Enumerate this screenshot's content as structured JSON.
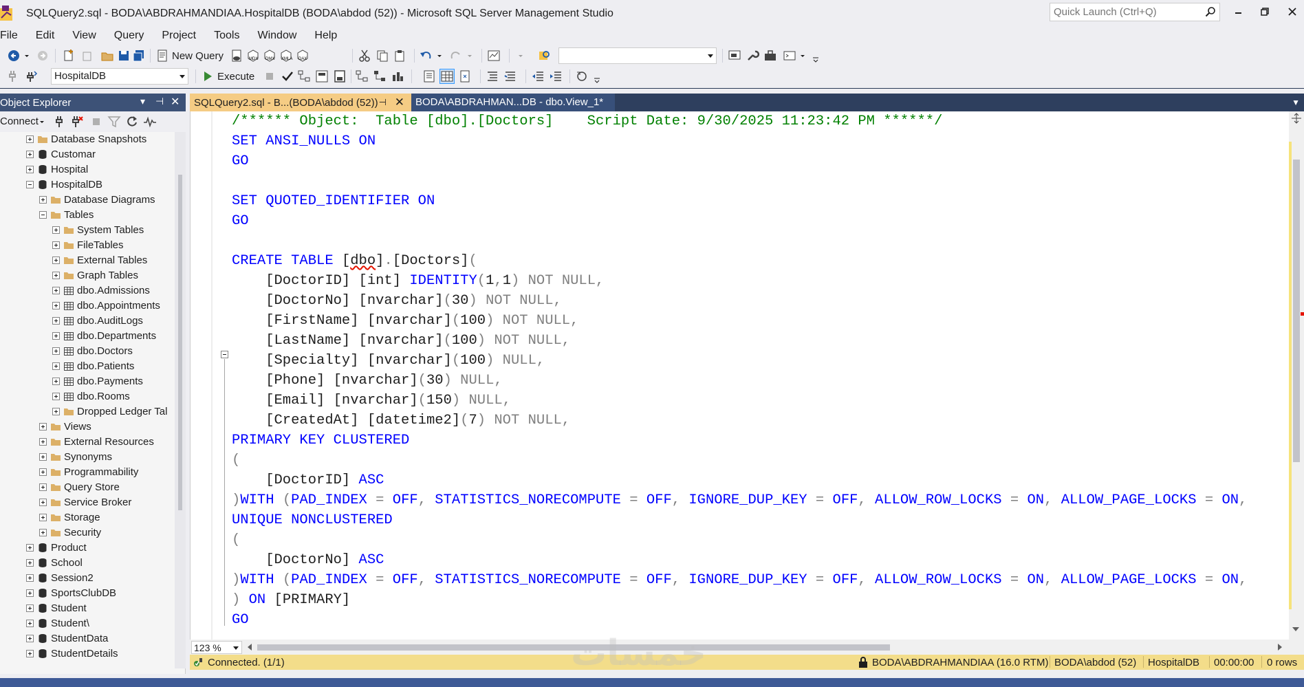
{
  "window": {
    "title": "SQLQuery2.sql - BODA\\ABDRAHMANDIAA.HospitalDB (BODA\\abdod (52)) - Microsoft SQL Server Management Studio",
    "quick_launch_placeholder": "Quick Launch (Ctrl+Q)"
  },
  "menu": [
    "File",
    "Edit",
    "View",
    "Query",
    "Project",
    "Tools",
    "Window",
    "Help"
  ],
  "toolbar": {
    "new_query": "New Query",
    "execute": "Execute",
    "database": "HospitalDB",
    "solution_config": ""
  },
  "object_explorer": {
    "title": "Object Explorer",
    "connect": "Connect",
    "items": [
      {
        "label": "Database Snapshots",
        "level": 0,
        "icon": "folder",
        "exp": "plus"
      },
      {
        "label": "Customar",
        "level": 0,
        "icon": "db",
        "exp": "plus"
      },
      {
        "label": "Hospital",
        "level": 0,
        "icon": "db",
        "exp": "plus"
      },
      {
        "label": "HospitalDB",
        "level": 0,
        "icon": "db",
        "exp": "minus"
      },
      {
        "label": "Database Diagrams",
        "level": 1,
        "icon": "folder",
        "exp": "plus"
      },
      {
        "label": "Tables",
        "level": 1,
        "icon": "folder",
        "exp": "minus"
      },
      {
        "label": "System Tables",
        "level": 2,
        "icon": "folder",
        "exp": "plus"
      },
      {
        "label": "FileTables",
        "level": 2,
        "icon": "folder",
        "exp": "plus"
      },
      {
        "label": "External Tables",
        "level": 2,
        "icon": "folder",
        "exp": "plus"
      },
      {
        "label": "Graph Tables",
        "level": 2,
        "icon": "folder",
        "exp": "plus"
      },
      {
        "label": "dbo.Admissions",
        "level": 2,
        "icon": "table",
        "exp": "plus"
      },
      {
        "label": "dbo.Appointments",
        "level": 2,
        "icon": "table",
        "exp": "plus"
      },
      {
        "label": "dbo.AuditLogs",
        "level": 2,
        "icon": "table",
        "exp": "plus"
      },
      {
        "label": "dbo.Departments",
        "level": 2,
        "icon": "table",
        "exp": "plus"
      },
      {
        "label": "dbo.Doctors",
        "level": 2,
        "icon": "table",
        "exp": "plus"
      },
      {
        "label": "dbo.Patients",
        "level": 2,
        "icon": "table",
        "exp": "plus"
      },
      {
        "label": "dbo.Payments",
        "level": 2,
        "icon": "table",
        "exp": "plus"
      },
      {
        "label": "dbo.Rooms",
        "level": 2,
        "icon": "table",
        "exp": "plus"
      },
      {
        "label": "Dropped Ledger Tal",
        "level": 2,
        "icon": "folder",
        "exp": "plus"
      },
      {
        "label": "Views",
        "level": 1,
        "icon": "folder",
        "exp": "plus"
      },
      {
        "label": "External Resources",
        "level": 1,
        "icon": "folder",
        "exp": "plus"
      },
      {
        "label": "Synonyms",
        "level": 1,
        "icon": "folder",
        "exp": "plus"
      },
      {
        "label": "Programmability",
        "level": 1,
        "icon": "folder",
        "exp": "plus"
      },
      {
        "label": "Query Store",
        "level": 1,
        "icon": "folder",
        "exp": "plus"
      },
      {
        "label": "Service Broker",
        "level": 1,
        "icon": "folder",
        "exp": "plus"
      },
      {
        "label": "Storage",
        "level": 1,
        "icon": "folder",
        "exp": "plus"
      },
      {
        "label": "Security",
        "level": 1,
        "icon": "folder",
        "exp": "plus"
      },
      {
        "label": "Product",
        "level": 0,
        "icon": "db",
        "exp": "plus"
      },
      {
        "label": "School",
        "level": 0,
        "icon": "db",
        "exp": "plus"
      },
      {
        "label": "Session2",
        "level": 0,
        "icon": "db",
        "exp": "plus"
      },
      {
        "label": "SportsClubDB",
        "level": 0,
        "icon": "db",
        "exp": "plus"
      },
      {
        "label": "Student",
        "level": 0,
        "icon": "db",
        "exp": "plus"
      },
      {
        "label": "Student\\",
        "level": 0,
        "icon": "db",
        "exp": "plus"
      },
      {
        "label": "StudentData",
        "level": 0,
        "icon": "db",
        "exp": "plus"
      },
      {
        "label": "StudentDetails",
        "level": 0,
        "icon": "db",
        "exp": "plus"
      }
    ]
  },
  "tabs": {
    "active": "SQLQuery2.sql - B...(BODA\\abdod (52))",
    "inactive": "BODA\\ABDRAHMAN...DB - dbo.View_1*"
  },
  "code_lines": [
    [
      [
        "cm",
        "/****** Object:  Table [dbo].[Doctors]    Script Date: 9/30/2025 11:23:42 PM ******/"
      ]
    ],
    [
      [
        "kw",
        "SET ANSI_NULLS ON"
      ]
    ],
    [
      [
        "kw",
        "GO"
      ]
    ],
    [
      [
        "tx",
        ""
      ]
    ],
    [
      [
        "kw",
        "SET QUOTED_IDENTIFIER ON"
      ]
    ],
    [
      [
        "kw",
        "GO"
      ]
    ],
    [
      [
        "tx",
        ""
      ]
    ],
    [
      [
        "kw",
        "CREATE TABLE "
      ],
      [
        "tx",
        "["
      ],
      [
        "sq",
        "dbo"
      ],
      [
        "tx",
        "]"
      ],
      [
        "gr",
        "."
      ],
      [
        "tx",
        "[Doctors]"
      ],
      [
        "gr",
        "("
      ]
    ],
    [
      [
        "tx",
        "    [DoctorID] [int] "
      ],
      [
        "kw",
        "IDENTITY"
      ],
      [
        "gr",
        "("
      ],
      [
        "tx",
        "1"
      ],
      [
        "gr",
        ","
      ],
      [
        "tx",
        "1"
      ],
      [
        "gr",
        ") NOT NULL,"
      ]
    ],
    [
      [
        "tx",
        "    [DoctorNo] [nvarchar]"
      ],
      [
        "gr",
        "("
      ],
      [
        "tx",
        "30"
      ],
      [
        "gr",
        ") NOT NULL,"
      ]
    ],
    [
      [
        "tx",
        "    [FirstName] [nvarchar]"
      ],
      [
        "gr",
        "("
      ],
      [
        "tx",
        "100"
      ],
      [
        "gr",
        ") NOT NULL,"
      ]
    ],
    [
      [
        "tx",
        "    [LastName] [nvarchar]"
      ],
      [
        "gr",
        "("
      ],
      [
        "tx",
        "100"
      ],
      [
        "gr",
        ") NOT NULL,"
      ]
    ],
    [
      [
        "tx",
        "    [Specialty] [nvarchar]"
      ],
      [
        "gr",
        "("
      ],
      [
        "tx",
        "100"
      ],
      [
        "gr",
        ") NULL,"
      ]
    ],
    [
      [
        "tx",
        "    [Phone] [nvarchar]"
      ],
      [
        "gr",
        "("
      ],
      [
        "tx",
        "30"
      ],
      [
        "gr",
        ") NULL,"
      ]
    ],
    [
      [
        "tx",
        "    [Email] [nvarchar]"
      ],
      [
        "gr",
        "("
      ],
      [
        "tx",
        "150"
      ],
      [
        "gr",
        ") NULL,"
      ]
    ],
    [
      [
        "tx",
        "    [CreatedAt] [datetime2]"
      ],
      [
        "gr",
        "("
      ],
      [
        "tx",
        "7"
      ],
      [
        "gr",
        ") NOT NULL,"
      ]
    ],
    [
      [
        "kw",
        "PRIMARY KEY CLUSTERED"
      ]
    ],
    [
      [
        "gr",
        "("
      ]
    ],
    [
      [
        "tx",
        "    [DoctorID] "
      ],
      [
        "kw",
        "ASC"
      ]
    ],
    [
      [
        "gr",
        ")"
      ],
      [
        "kw",
        "WITH "
      ],
      [
        "gr",
        "("
      ],
      [
        "kw",
        "PAD_INDEX "
      ],
      [
        "gr",
        "= "
      ],
      [
        "kw",
        "OFF"
      ],
      [
        "gr",
        ", "
      ],
      [
        "kw",
        "STATISTICS_NORECOMPUTE "
      ],
      [
        "gr",
        "= "
      ],
      [
        "kw",
        "OFF"
      ],
      [
        "gr",
        ", "
      ],
      [
        "kw",
        "IGNORE_DUP_KEY "
      ],
      [
        "gr",
        "= "
      ],
      [
        "kw",
        "OFF"
      ],
      [
        "gr",
        ", "
      ],
      [
        "kw",
        "ALLOW_ROW_LOCKS "
      ],
      [
        "gr",
        "= "
      ],
      [
        "kw",
        "ON"
      ],
      [
        "gr",
        ", "
      ],
      [
        "kw",
        "ALLOW_PAGE_LOCKS "
      ],
      [
        "gr",
        "= "
      ],
      [
        "kw",
        "ON"
      ],
      [
        "gr",
        ","
      ]
    ],
    [
      [
        "kw",
        "UNIQUE NONCLUSTERED"
      ]
    ],
    [
      [
        "gr",
        "("
      ]
    ],
    [
      [
        "tx",
        "    [DoctorNo] "
      ],
      [
        "kw",
        "ASC"
      ]
    ],
    [
      [
        "gr",
        ")"
      ],
      [
        "kw",
        "WITH "
      ],
      [
        "gr",
        "("
      ],
      [
        "kw",
        "PAD_INDEX "
      ],
      [
        "gr",
        "= "
      ],
      [
        "kw",
        "OFF"
      ],
      [
        "gr",
        ", "
      ],
      [
        "kw",
        "STATISTICS_NORECOMPUTE "
      ],
      [
        "gr",
        "= "
      ],
      [
        "kw",
        "OFF"
      ],
      [
        "gr",
        ", "
      ],
      [
        "kw",
        "IGNORE_DUP_KEY "
      ],
      [
        "gr",
        "= "
      ],
      [
        "kw",
        "OFF"
      ],
      [
        "gr",
        ", "
      ],
      [
        "kw",
        "ALLOW_ROW_LOCKS "
      ],
      [
        "gr",
        "= "
      ],
      [
        "kw",
        "ON"
      ],
      [
        "gr",
        ", "
      ],
      [
        "kw",
        "ALLOW_PAGE_LOCKS "
      ],
      [
        "gr",
        "= "
      ],
      [
        "kw",
        "ON"
      ],
      [
        "gr",
        ","
      ]
    ],
    [
      [
        "gr",
        ") "
      ],
      [
        "kw",
        "ON "
      ],
      [
        "tx",
        "[PRIMARY]"
      ]
    ],
    [
      [
        "kw",
        "GO"
      ]
    ]
  ],
  "editor": {
    "zoom": "123 %"
  },
  "status": {
    "connected": "Connected. (1/1)",
    "server": "BODA\\ABDRAHMANDIAA (16.0 RTM)",
    "user": "BODA\\abdod (52)",
    "database": "HospitalDB",
    "elapsed": "00:00:00",
    "rows": "0 rows"
  },
  "colors": {
    "status_bar": "#f3dd8a",
    "tab_active": "#f5cc84",
    "keyword": "#0000ff",
    "comment": "#008000",
    "panel_header": "#3d5277"
  }
}
